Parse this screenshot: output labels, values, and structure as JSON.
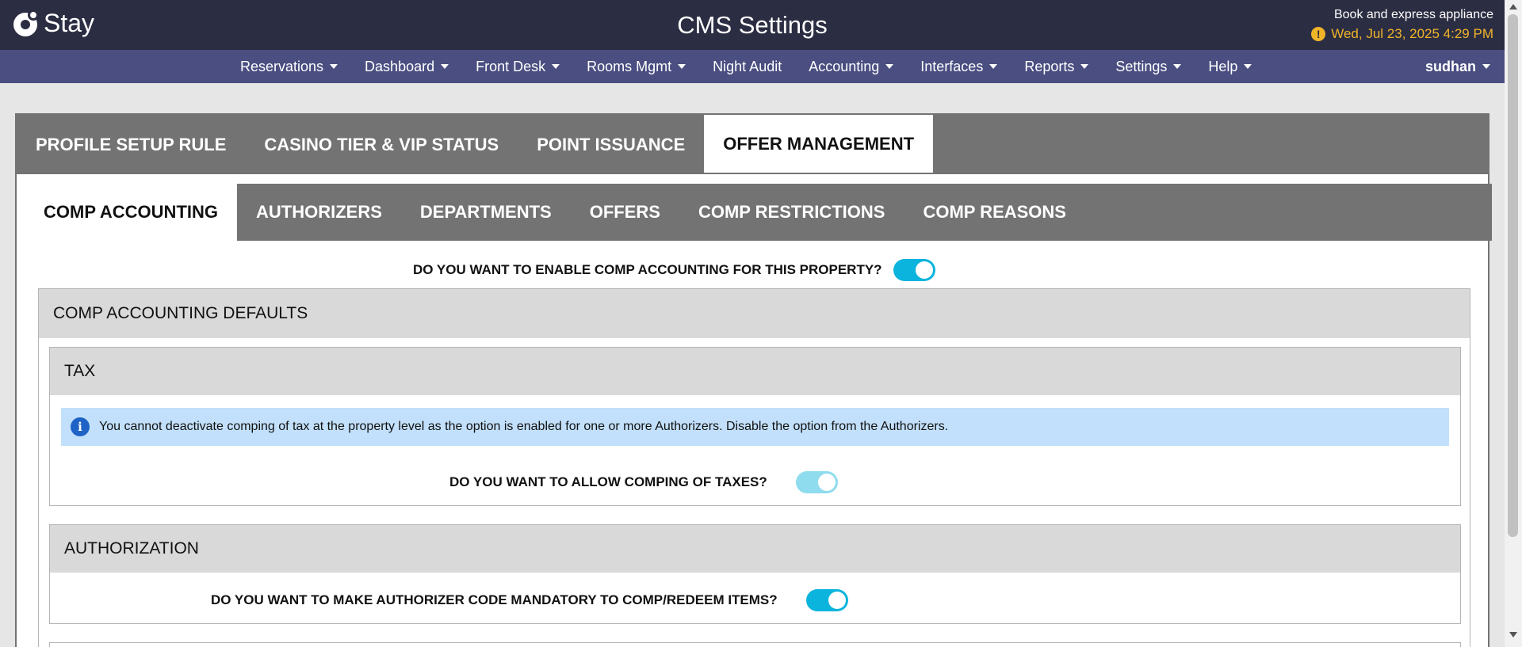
{
  "app": {
    "logo_text": "Stay",
    "page_title": "CMS Settings",
    "property_name": "Book and express appliance",
    "datetime": "Wed, Jul 23, 2025 4:29 PM"
  },
  "nav": {
    "items": [
      {
        "label": "Reservations",
        "dropdown": true
      },
      {
        "label": "Dashboard",
        "dropdown": true
      },
      {
        "label": "Front Desk",
        "dropdown": true
      },
      {
        "label": "Rooms Mgmt",
        "dropdown": true
      },
      {
        "label": "Night Audit",
        "dropdown": false
      },
      {
        "label": "Accounting",
        "dropdown": true
      },
      {
        "label": "Interfaces",
        "dropdown": true
      },
      {
        "label": "Reports",
        "dropdown": true
      },
      {
        "label": "Settings",
        "dropdown": true
      },
      {
        "label": "Help",
        "dropdown": true
      }
    ],
    "user": "sudhan"
  },
  "primary_tabs": [
    {
      "label": "PROFILE SETUP RULE",
      "active": false
    },
    {
      "label": "CASINO TIER & VIP STATUS",
      "active": false
    },
    {
      "label": "POINT ISSUANCE",
      "active": false
    },
    {
      "label": "OFFER MANAGEMENT",
      "active": true
    }
  ],
  "secondary_tabs": [
    {
      "label": "COMP ACCOUNTING",
      "active": true
    },
    {
      "label": "AUTHORIZERS",
      "active": false
    },
    {
      "label": "DEPARTMENTS",
      "active": false
    },
    {
      "label": "OFFERS",
      "active": false
    },
    {
      "label": "COMP RESTRICTIONS",
      "active": false
    },
    {
      "label": "COMP REASONS",
      "active": false
    }
  ],
  "comp_accounting": {
    "enable_question": "DO YOU WANT TO ENABLE COMP ACCOUNTING FOR THIS PROPERTY?",
    "enable_on": true,
    "defaults_title": "COMP ACCOUNTING DEFAULTS",
    "tax": {
      "title": "TAX",
      "info_message": "You cannot deactivate comping of tax at the property level as the option is enabled for one or more Authorizers. Disable the option from the Authorizers.",
      "question": "DO YOU WANT TO ALLOW COMPING OF TAXES?",
      "value_on": true,
      "disabled": true
    },
    "authorization": {
      "title": "AUTHORIZATION",
      "question": "DO YOU WANT TO MAKE AUTHORIZER CODE MANDATORY TO COMP/REDEEM ITEMS?",
      "value_on": true
    }
  },
  "colors": {
    "header_bg": "#2b2d42",
    "nav_bg": "#4a4e80",
    "tab_bg": "#737373",
    "toggle_on": "#0bb4dd",
    "datetime": "#f0b429",
    "info_bg": "#c2e0fb"
  }
}
